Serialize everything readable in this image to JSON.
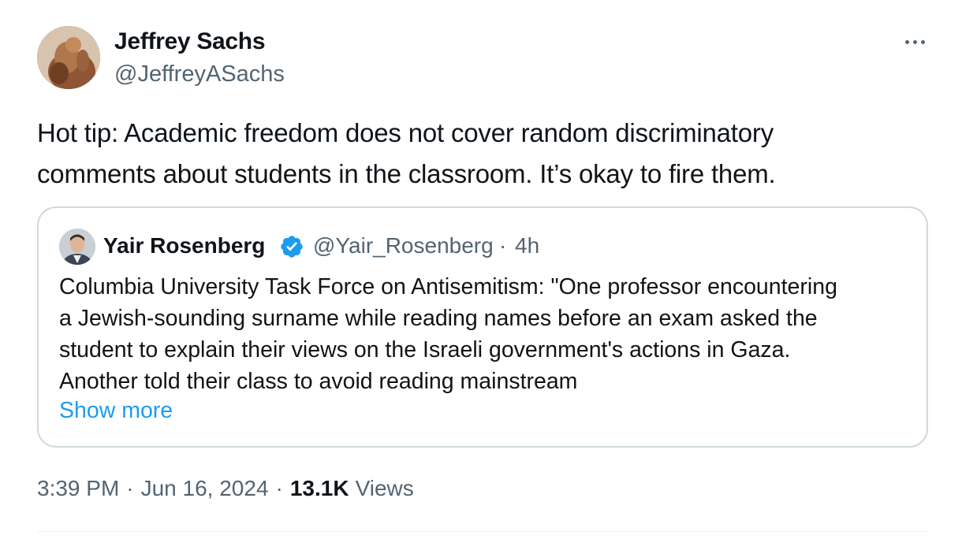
{
  "author": {
    "name": "Jeffrey Sachs",
    "handle": "@JeffreyASachs"
  },
  "tweet": {
    "text_lines": [
      "Hot tip: Academic freedom does not cover random discriminatory",
      "comments about students in the classroom. It’s okay to fire them."
    ]
  },
  "quote": {
    "name": "Yair Rosenberg",
    "handle": "@Yair_Rosenberg",
    "separator": "·",
    "time": "4h",
    "text_lines": [
      "Columbia University Task Force on Antisemitism: \"One professor encountering",
      "a Jewish-sounding surname while reading names before an exam asked the",
      "student to explain their views on the Israeli government's actions in Gaza.",
      "Another told their class to avoid reading mainstream"
    ],
    "show_more": "Show more"
  },
  "meta": {
    "time": "3:39 PM",
    "separator": "·",
    "date": "Jun 16, 2024",
    "views_count": "13.1K",
    "views_label": "Views"
  },
  "colors": {
    "text": "#0f1419",
    "secondary": "#536471",
    "link": "#1d9bf0",
    "border": "#cfd9de",
    "verified": "#1d9bf0"
  },
  "icons": {
    "more": "more-horizontal-icon",
    "verified": "verified-badge-icon"
  }
}
